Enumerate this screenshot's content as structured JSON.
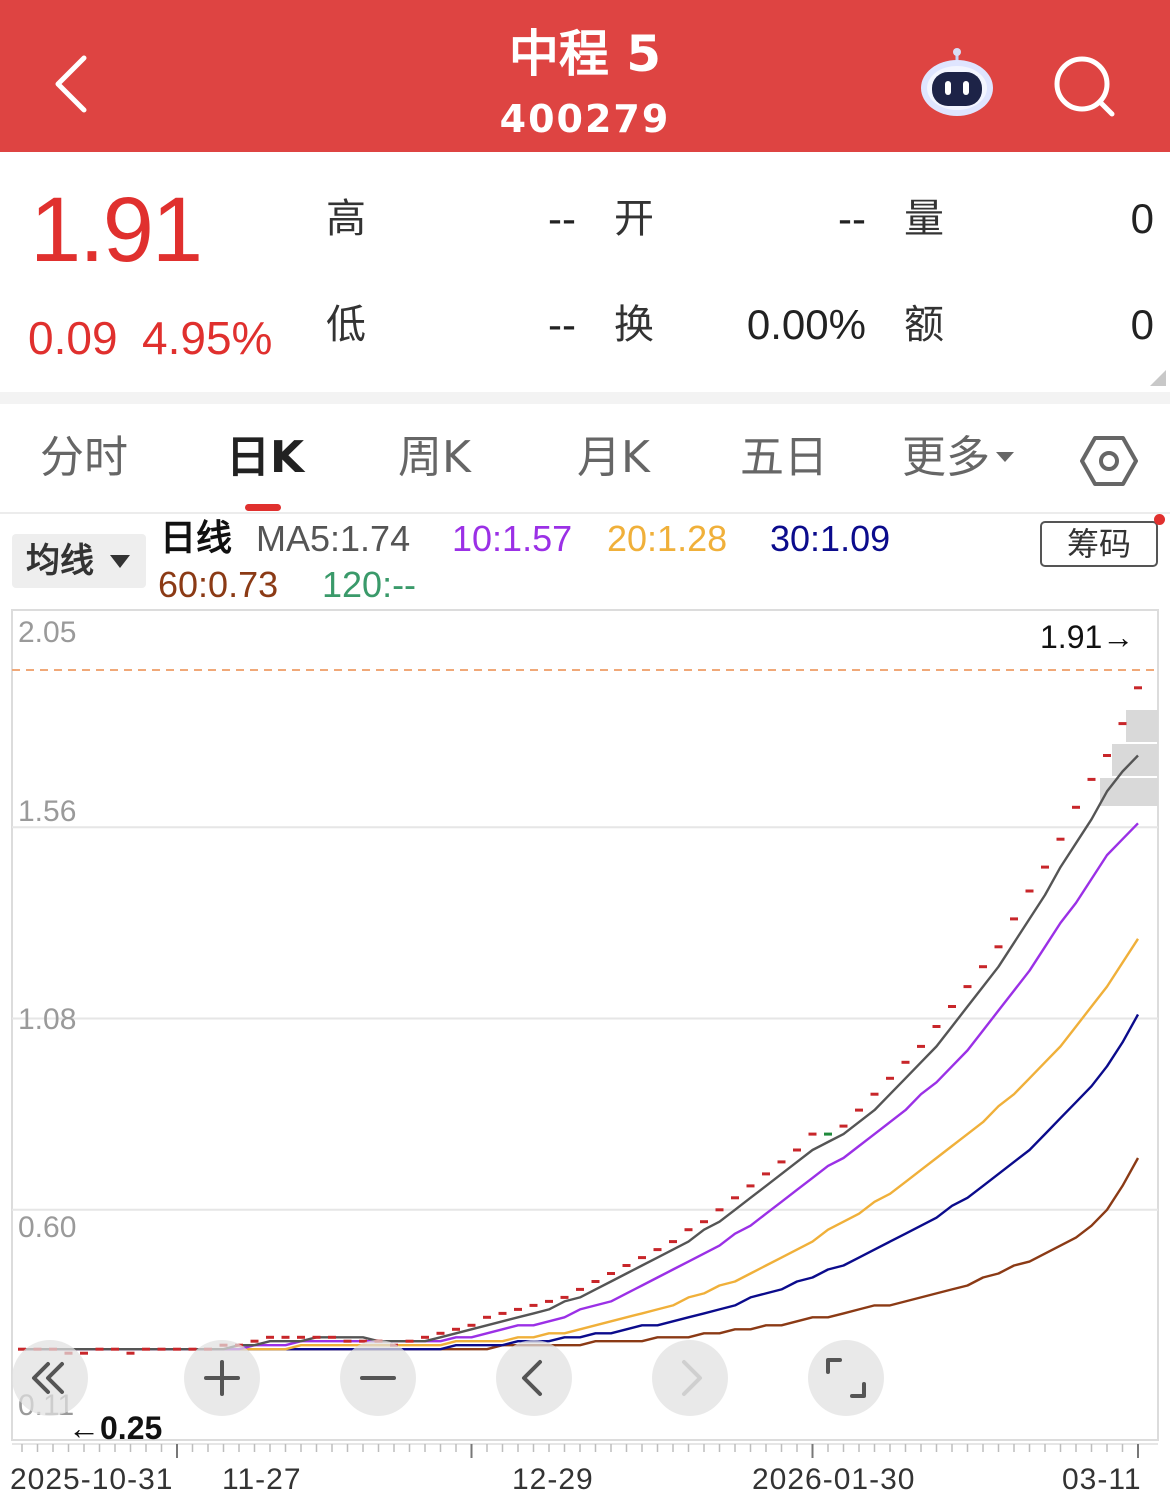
{
  "header": {
    "title": "中程 5",
    "code": "400279",
    "background": "#de4442"
  },
  "quote": {
    "price": "1.91",
    "change": "0.09",
    "change_pct": "4.95%",
    "up_color": "#e0302e",
    "fields": {
      "high_label": "高",
      "high_value": "--",
      "open_label": "开",
      "open_value": "--",
      "volume_label": "量",
      "volume_value": "0",
      "low_label": "低",
      "low_value": "--",
      "turnover_label": "换",
      "turnover_value": "0.00%",
      "amount_label": "额",
      "amount_value": "0"
    }
  },
  "tabs": [
    {
      "label": "分时",
      "active": false
    },
    {
      "label": "日K",
      "active": true
    },
    {
      "label": "周K",
      "active": false
    },
    {
      "label": "月K",
      "active": false
    },
    {
      "label": "五日",
      "active": false
    },
    {
      "label": "更多",
      "active": false
    }
  ],
  "indicator": {
    "selector": "均线",
    "period": "日线",
    "ma5": "MA5:1.74",
    "ma10": "10:1.57",
    "ma20": "20:1.28",
    "ma30": "30:1.09",
    "ma60": "60:0.73",
    "ma120": "120:--",
    "chips_button": "筹码",
    "colors": {
      "ma5": "#555555",
      "ma10": "#9b30e6",
      "ma20": "#f0b03a",
      "ma30": "#0b0b8c",
      "ma60": "#8b3a15",
      "ma120": "#3a9a6a"
    }
  },
  "chart_data": {
    "type": "line",
    "title": "",
    "y_ticks": [
      "2.05",
      "1.56",
      "1.08",
      "0.60",
      "0.11"
    ],
    "ylim": [
      0.11,
      2.05
    ],
    "x_ticks": [
      "2025-10-31",
      "11-27",
      "12-29",
      "2026-01-30",
      "03-11"
    ],
    "last_price_label": "1.91→",
    "low_price_label": "←0.25",
    "reference_line": 1.91,
    "candles_note": "daily limit-up bars",
    "candles": [
      0.25,
      0.25,
      0.25,
      0.24,
      0.24,
      0.25,
      0.25,
      0.24,
      0.25,
      0.25,
      0.25,
      0.25,
      0.25,
      0.26,
      0.26,
      0.27,
      0.28,
      0.28,
      0.28,
      0.28,
      0.28,
      0.27,
      0.27,
      0.27,
      0.26,
      0.27,
      0.28,
      0.29,
      0.3,
      0.31,
      0.33,
      0.34,
      0.35,
      0.36,
      0.37,
      0.38,
      0.4,
      0.42,
      0.44,
      0.46,
      0.48,
      0.5,
      0.52,
      0.55,
      0.57,
      0.6,
      0.63,
      0.66,
      0.69,
      0.72,
      0.75,
      0.79,
      0.79,
      0.81,
      0.85,
      0.89,
      0.93,
      0.97,
      1.01,
      1.06,
      1.11,
      1.16,
      1.21,
      1.26,
      1.33,
      1.4,
      1.46,
      1.53,
      1.61,
      1.68,
      1.74,
      1.82,
      1.91
    ],
    "series": [
      {
        "name": "MA5",
        "color": "#555555",
        "values": [
          0.25,
          0.25,
          0.25,
          0.25,
          0.25,
          0.25,
          0.25,
          0.25,
          0.25,
          0.25,
          0.25,
          0.25,
          0.25,
          0.25,
          0.26,
          0.26,
          0.27,
          0.27,
          0.27,
          0.28,
          0.28,
          0.28,
          0.28,
          0.27,
          0.27,
          0.27,
          0.27,
          0.28,
          0.29,
          0.3,
          0.31,
          0.32,
          0.33,
          0.34,
          0.35,
          0.37,
          0.38,
          0.4,
          0.42,
          0.44,
          0.46,
          0.48,
          0.5,
          0.52,
          0.55,
          0.57,
          0.6,
          0.63,
          0.66,
          0.69,
          0.72,
          0.75,
          0.77,
          0.79,
          0.82,
          0.85,
          0.89,
          0.93,
          0.97,
          1.01,
          1.06,
          1.11,
          1.16,
          1.21,
          1.27,
          1.33,
          1.39,
          1.46,
          1.52,
          1.58,
          1.65,
          1.7,
          1.74
        ]
      },
      {
        "name": "MA10",
        "color": "#9b30e6",
        "values": [
          0.25,
          0.25,
          0.25,
          0.25,
          0.25,
          0.25,
          0.25,
          0.25,
          0.25,
          0.25,
          0.25,
          0.25,
          0.25,
          0.25,
          0.25,
          0.26,
          0.26,
          0.26,
          0.27,
          0.27,
          0.27,
          0.27,
          0.27,
          0.27,
          0.27,
          0.27,
          0.27,
          0.27,
          0.28,
          0.28,
          0.29,
          0.3,
          0.31,
          0.31,
          0.32,
          0.33,
          0.35,
          0.36,
          0.37,
          0.39,
          0.41,
          0.43,
          0.45,
          0.47,
          0.49,
          0.51,
          0.54,
          0.56,
          0.59,
          0.62,
          0.65,
          0.68,
          0.71,
          0.73,
          0.76,
          0.79,
          0.82,
          0.85,
          0.89,
          0.92,
          0.96,
          1.0,
          1.05,
          1.1,
          1.15,
          1.2,
          1.26,
          1.32,
          1.37,
          1.43,
          1.49,
          1.53,
          1.57
        ]
      },
      {
        "name": "MA20",
        "color": "#f0b03a",
        "values": [
          0.25,
          0.25,
          0.25,
          0.25,
          0.25,
          0.25,
          0.25,
          0.25,
          0.25,
          0.25,
          0.25,
          0.25,
          0.25,
          0.25,
          0.25,
          0.25,
          0.25,
          0.25,
          0.26,
          0.26,
          0.26,
          0.26,
          0.26,
          0.26,
          0.26,
          0.26,
          0.26,
          0.26,
          0.27,
          0.27,
          0.27,
          0.27,
          0.28,
          0.28,
          0.29,
          0.29,
          0.3,
          0.31,
          0.32,
          0.33,
          0.34,
          0.35,
          0.36,
          0.38,
          0.39,
          0.41,
          0.42,
          0.44,
          0.46,
          0.48,
          0.5,
          0.52,
          0.55,
          0.57,
          0.59,
          0.62,
          0.64,
          0.67,
          0.7,
          0.73,
          0.76,
          0.79,
          0.82,
          0.86,
          0.89,
          0.93,
          0.97,
          1.01,
          1.06,
          1.11,
          1.16,
          1.22,
          1.28
        ]
      },
      {
        "name": "MA30",
        "color": "#0b0b8c",
        "values": [
          0.25,
          0.25,
          0.25,
          0.25,
          0.25,
          0.25,
          0.25,
          0.25,
          0.25,
          0.25,
          0.25,
          0.25,
          0.25,
          0.25,
          0.25,
          0.25,
          0.25,
          0.25,
          0.25,
          0.25,
          0.25,
          0.25,
          0.25,
          0.25,
          0.25,
          0.25,
          0.25,
          0.25,
          0.26,
          0.26,
          0.26,
          0.26,
          0.27,
          0.27,
          0.27,
          0.28,
          0.28,
          0.29,
          0.29,
          0.3,
          0.31,
          0.31,
          0.32,
          0.33,
          0.34,
          0.35,
          0.36,
          0.38,
          0.39,
          0.4,
          0.42,
          0.43,
          0.45,
          0.46,
          0.48,
          0.5,
          0.52,
          0.54,
          0.56,
          0.58,
          0.61,
          0.63,
          0.66,
          0.69,
          0.72,
          0.75,
          0.79,
          0.83,
          0.87,
          0.91,
          0.96,
          1.02,
          1.09
        ]
      },
      {
        "name": "MA60",
        "color": "#8b3a15",
        "values": [
          0.25,
          0.25,
          0.25,
          0.25,
          0.25,
          0.25,
          0.25,
          0.25,
          0.25,
          0.25,
          0.25,
          0.25,
          0.25,
          0.25,
          0.25,
          0.25,
          0.25,
          0.25,
          0.25,
          0.25,
          0.25,
          0.25,
          0.25,
          0.25,
          0.25,
          0.25,
          0.25,
          0.25,
          0.25,
          0.25,
          0.25,
          0.26,
          0.26,
          0.26,
          0.26,
          0.26,
          0.26,
          0.27,
          0.27,
          0.27,
          0.27,
          0.28,
          0.28,
          0.28,
          0.29,
          0.29,
          0.3,
          0.3,
          0.31,
          0.31,
          0.32,
          0.33,
          0.33,
          0.34,
          0.35,
          0.36,
          0.36,
          0.37,
          0.38,
          0.39,
          0.4,
          0.41,
          0.43,
          0.44,
          0.46,
          0.47,
          0.49,
          0.51,
          0.53,
          0.56,
          0.6,
          0.66,
          0.73
        ]
      }
    ]
  },
  "controls": {
    "rewind_icon": "double-chevron-left-icon",
    "zoom_in_icon": "plus-icon",
    "zoom_out_icon": "minus-icon",
    "prev_icon": "chevron-left-icon",
    "next_icon": "chevron-right-icon",
    "fullscreen_icon": "fullscreen-icon"
  }
}
